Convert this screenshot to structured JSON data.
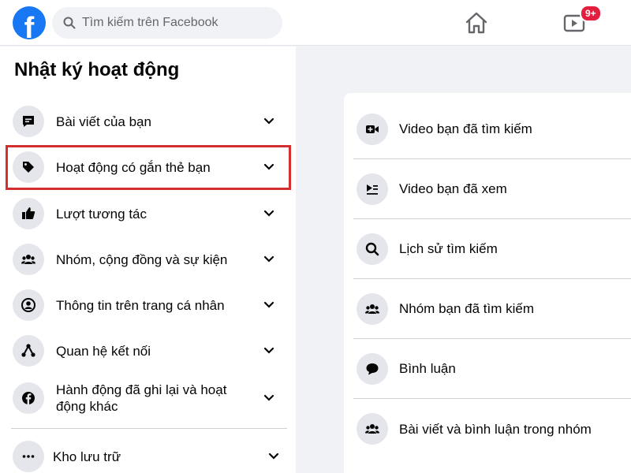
{
  "header": {
    "search_placeholder": "Tìm kiếm trên Facebook",
    "logo_letter": "f",
    "watch_badge": "9+"
  },
  "sidebar": {
    "title": "Nhật ký hoạt động",
    "items": [
      {
        "label": "Bài viết của bạn",
        "icon": "post-icon"
      },
      {
        "label": "Hoạt động có gắn thẻ bạn",
        "icon": "tag-icon"
      },
      {
        "label": "Lượt tương tác",
        "icon": "like-icon"
      },
      {
        "label": "Nhóm, cộng đồng và sự kiện",
        "icon": "groups-icon"
      },
      {
        "label": "Thông tin trên trang cá nhân",
        "icon": "profile-icon"
      },
      {
        "label": "Quan hệ kết nối",
        "icon": "connections-icon"
      },
      {
        "label": "Hành động đã ghi lại và hoạt động khác",
        "icon": "facebook-icon"
      }
    ],
    "archive_label": "Kho lưu trữ"
  },
  "panel": {
    "items": [
      {
        "label": "Video bạn đã tìm kiếm",
        "icon": "video-search-icon"
      },
      {
        "label": "Video bạn đã xem",
        "icon": "video-watched-icon"
      },
      {
        "label": "Lịch sử tìm kiếm",
        "icon": "search-icon"
      },
      {
        "label": "Nhóm bạn đã tìm kiếm",
        "icon": "groups-icon"
      },
      {
        "label": "Bình luận",
        "icon": "comment-icon"
      },
      {
        "label": "Bài viết và bình luận trong nhóm",
        "icon": "groups-icon"
      }
    ]
  },
  "colors": {
    "brand": "#1877f2",
    "highlight": "#d32f2f",
    "badge": "#e41e3f"
  }
}
